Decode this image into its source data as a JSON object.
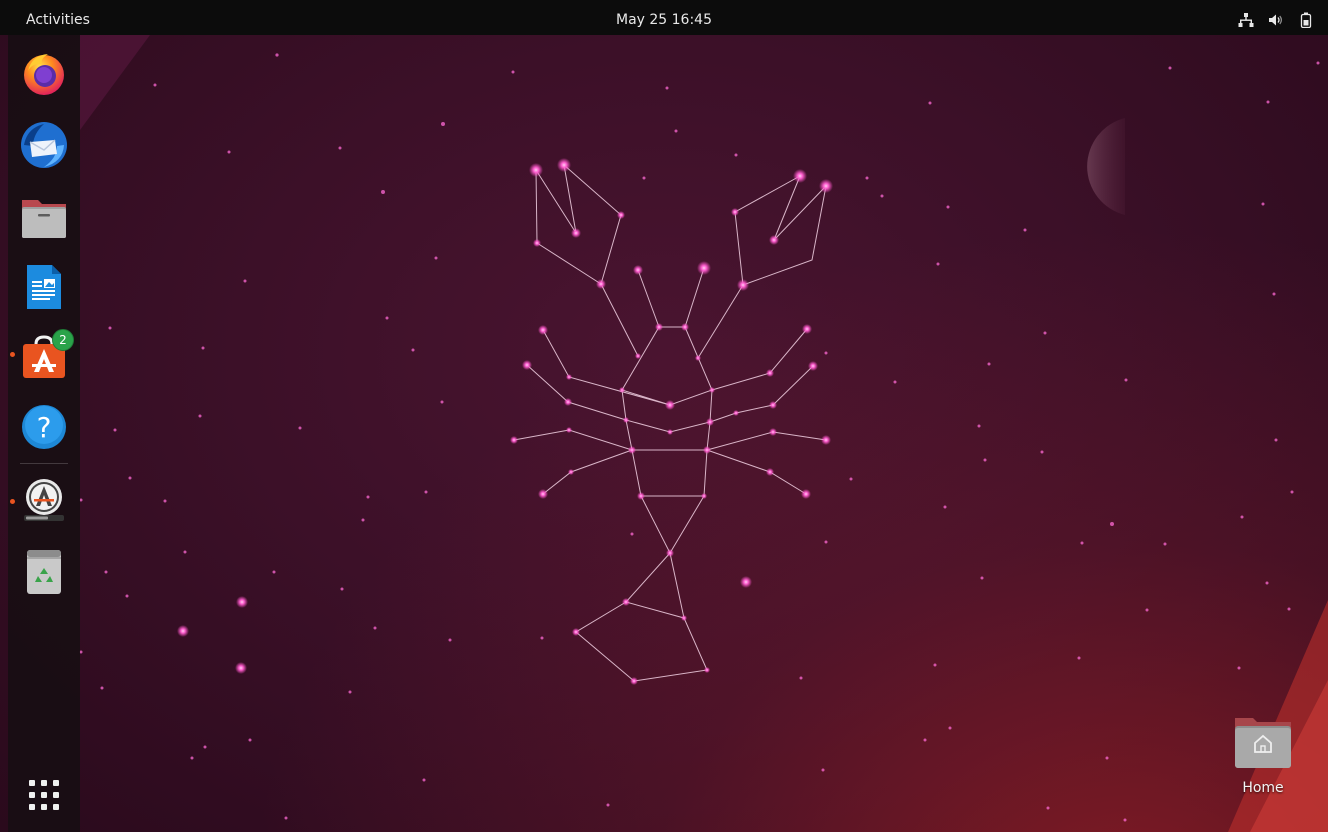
{
  "topbar": {
    "activities_label": "Activities",
    "clock": "May 25  16:45",
    "tray_icons": [
      "network-icon",
      "volume-icon",
      "battery-icon"
    ]
  },
  "dock": {
    "items": [
      {
        "name": "Firefox",
        "icon": "firefox-icon",
        "running": false
      },
      {
        "name": "Thunderbird",
        "icon": "thunderbird-icon",
        "running": false
      },
      {
        "name": "Files",
        "icon": "files-icon",
        "running": false
      },
      {
        "name": "LibreOffice Writer",
        "icon": "libreoffice-writer-icon",
        "running": false
      },
      {
        "name": "Ubuntu Software",
        "icon": "software-store-icon",
        "running": true,
        "badge": "2"
      },
      {
        "name": "Help",
        "icon": "help-icon",
        "running": false
      },
      {
        "name": "Software Updater",
        "icon": "software-updater-icon",
        "running": true
      },
      {
        "name": "Trash",
        "icon": "trash-icon",
        "running": false
      }
    ],
    "show_apps_icon": "app-grid-icon"
  },
  "desktop": {
    "home_label": "Home"
  },
  "colors": {
    "topbar_bg": "#0c0c0c",
    "dock_bg": "#180e14",
    "accent_orange": "#e95420",
    "wallpaper_base": "#3c1028",
    "star_pink": "#ff6ad5"
  }
}
